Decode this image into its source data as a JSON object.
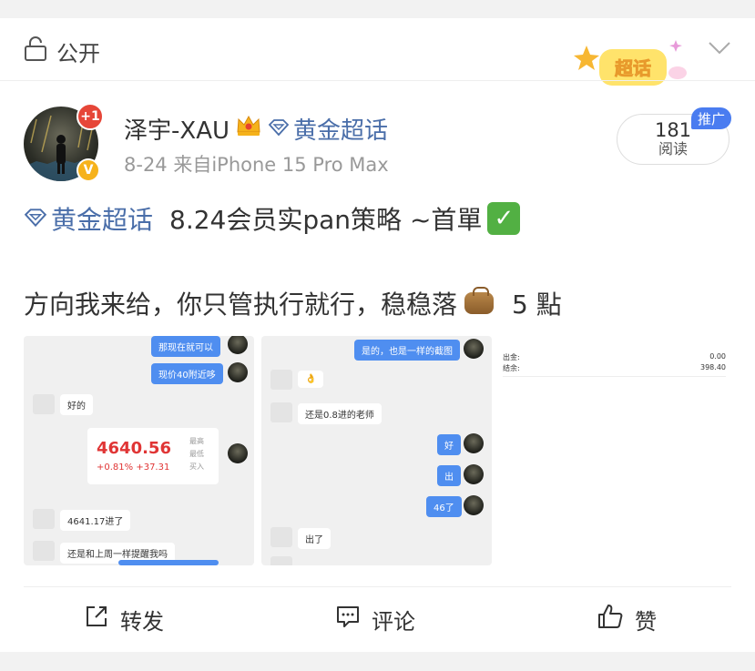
{
  "privacy": {
    "label": "公开"
  },
  "supertopic_badge": "超话",
  "author": {
    "name": "泽宇-XAU",
    "topic": "黄金超话",
    "avatar_notification": "+1",
    "verified_mark": "V",
    "meta": "8-24  来自iPhone 15 Pro Max"
  },
  "reads": {
    "count": "181",
    "label": "阅读",
    "promo": "推广"
  },
  "post": {
    "topic": "黄金超话",
    "line1_text": "8.24会员实pan策略 ~首單",
    "line2_before": "方向我来给，你只管执行就行，稳稳落",
    "line2_after": "5 點"
  },
  "image1": {
    "msgs": [
      "那现在就可以",
      "现价40附近哆",
      "好的",
      "4641.17进了",
      "还是和上周一样提醒我吗"
    ],
    "quote": {
      "price": "4640.56",
      "change": "+0.81%  +37.31",
      "side": [
        "最高",
        "最低",
        "买入"
      ]
    }
  },
  "image2": {
    "msgs": [
      "是的，也是一样的截图",
      "还是0.8进的老师",
      "好",
      "出",
      "46了",
      "出了"
    ]
  },
  "image3": {
    "rows": [
      {
        "label": "出金:",
        "value": "0.00"
      },
      {
        "label": "结余:",
        "value": "398.40"
      }
    ]
  },
  "actions": {
    "repost": "转发",
    "comment": "评论",
    "like": "赞"
  },
  "colors": {
    "link": "#4a6ea9",
    "promo": "#4a7cf0",
    "bubble": "#4f8ef0",
    "price": "#e03535"
  }
}
